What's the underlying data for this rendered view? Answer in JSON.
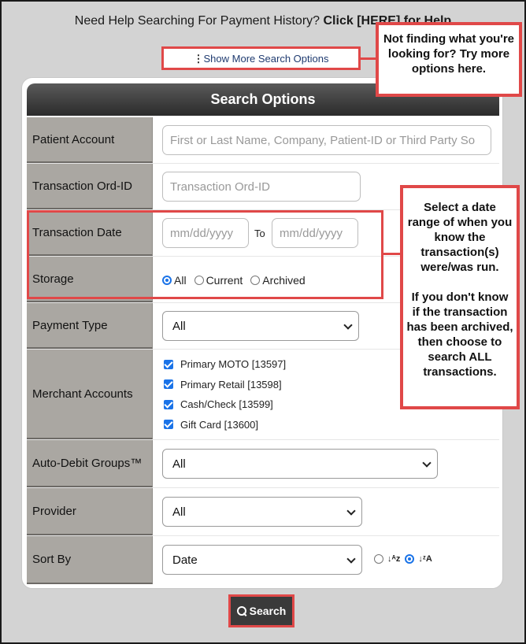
{
  "help": {
    "prefix": "Need Help Searching For Payment History? ",
    "link": "Click [HERE] for Help"
  },
  "show_more_label": "Show More Search Options",
  "panel_title": "Search Options",
  "fields": {
    "patient_account": {
      "label": "Patient Account",
      "placeholder": "First or Last Name, Company, Patient-ID or Third Party So"
    },
    "transaction_ord_id": {
      "label": "Transaction Ord-ID",
      "placeholder": "Transaction Ord-ID"
    },
    "transaction_date": {
      "label": "Transaction Date",
      "from_placeholder": "mm/dd/yyyy",
      "to_label": "To",
      "to_placeholder": "mm/dd/yyyy"
    },
    "storage": {
      "label": "Storage",
      "options": [
        "All",
        "Current",
        "Archived"
      ],
      "selected": "All"
    },
    "payment_type": {
      "label": "Payment Type",
      "value": "All"
    },
    "merchant_accounts": {
      "label": "Merchant Accounts",
      "items": [
        {
          "label": "Primary MOTO [13597]",
          "checked": true
        },
        {
          "label": "Primary Retail [13598]",
          "checked": true
        },
        {
          "label": "Cash/Check [13599]",
          "checked": true
        },
        {
          "label": "Gift Card [13600]",
          "checked": true
        }
      ]
    },
    "auto_debit_groups": {
      "label": "Auto-Debit Groups™",
      "value": "All"
    },
    "provider": {
      "label": "Provider",
      "value": "All"
    },
    "sort_by": {
      "label": "Sort By",
      "value": "Date",
      "ascending_selected": false,
      "descending_selected": true
    }
  },
  "callouts": {
    "top": "Not finding what you're looking for? Try more options here.",
    "right_1": "Select a date range of when you know the transaction(s) were/was run.",
    "right_2": "If you don't know if the transaction has been archived, then choose to search ALL transactions."
  },
  "search_button": "Search",
  "colors": {
    "highlight": "#e04848",
    "label_bg": "#aaa7a2",
    "header_dark": "#2b2b2b",
    "accent_blue": "#1a73e8"
  }
}
